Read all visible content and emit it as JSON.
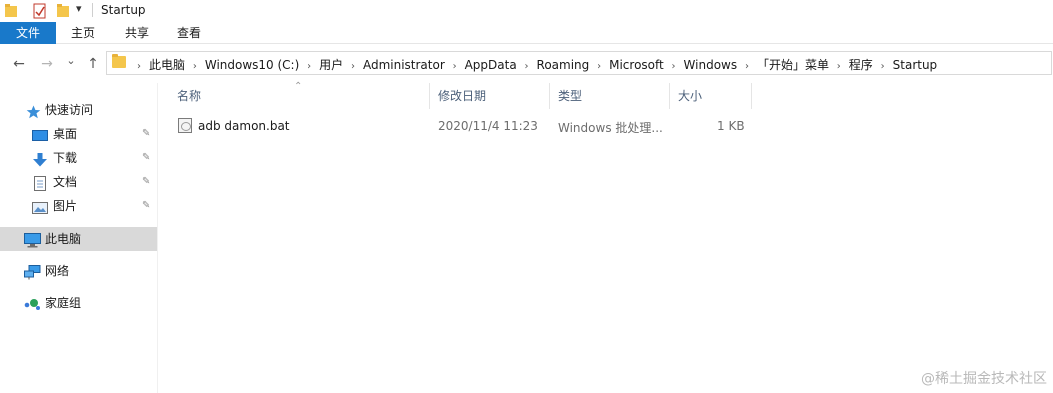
{
  "title_bar": {
    "title": "Startup",
    "icons": [
      "folder-icon",
      "properties-check-icon",
      "new-folder-icon",
      "customize-qat-icon"
    ],
    "dropdown_glyph": "▾"
  },
  "ribbon": {
    "tabs": [
      {
        "label": "文件",
        "active": true
      },
      {
        "label": "主页"
      },
      {
        "label": "共享"
      },
      {
        "label": "查看"
      }
    ]
  },
  "nav": {
    "back_glyph": "←",
    "forward_glyph": "→",
    "recent_glyph": "⌄",
    "up_glyph": "↑",
    "breadcrumb_sep": "›",
    "breadcrumbs": [
      "此电脑",
      "Windows10 (C:)",
      "用户",
      "Administrator",
      "AppData",
      "Roaming",
      "Microsoft",
      "Windows",
      "「开始」菜单",
      "程序",
      "Startup"
    ]
  },
  "sidebar": {
    "pin_glyph": "✎",
    "quick_access": {
      "label": "快速访问",
      "icon": "star-icon"
    },
    "items": [
      {
        "label": "桌面",
        "icon": "desktop-icon",
        "pinned": true
      },
      {
        "label": "下载",
        "icon": "download-icon",
        "pinned": true
      },
      {
        "label": "文档",
        "icon": "documents-icon",
        "pinned": true
      },
      {
        "label": "图片",
        "icon": "pictures-icon",
        "pinned": true
      }
    ],
    "this_pc": {
      "label": "此电脑",
      "icon": "computer-icon",
      "selected": true
    },
    "network": {
      "label": "网络",
      "icon": "network-icon"
    },
    "homegroup": {
      "label": "家庭组",
      "icon": "homegroup-icon"
    }
  },
  "table": {
    "sort_glyph": "⌃",
    "columns": [
      "名称",
      "修改日期",
      "类型",
      "大小"
    ],
    "rows": [
      {
        "name": "adb damon.bat",
        "modified": "2020/11/4 11:23",
        "type": "Windows 批处理...",
        "size": "1 KB",
        "icon": "batch-file-icon"
      }
    ]
  },
  "watermark": "@稀土掘金技术社区",
  "colors": {
    "accent": "#1979ca",
    "selected": "#d9d9d9",
    "folder": "#f4c64c",
    "header_text": "#4c607a"
  }
}
